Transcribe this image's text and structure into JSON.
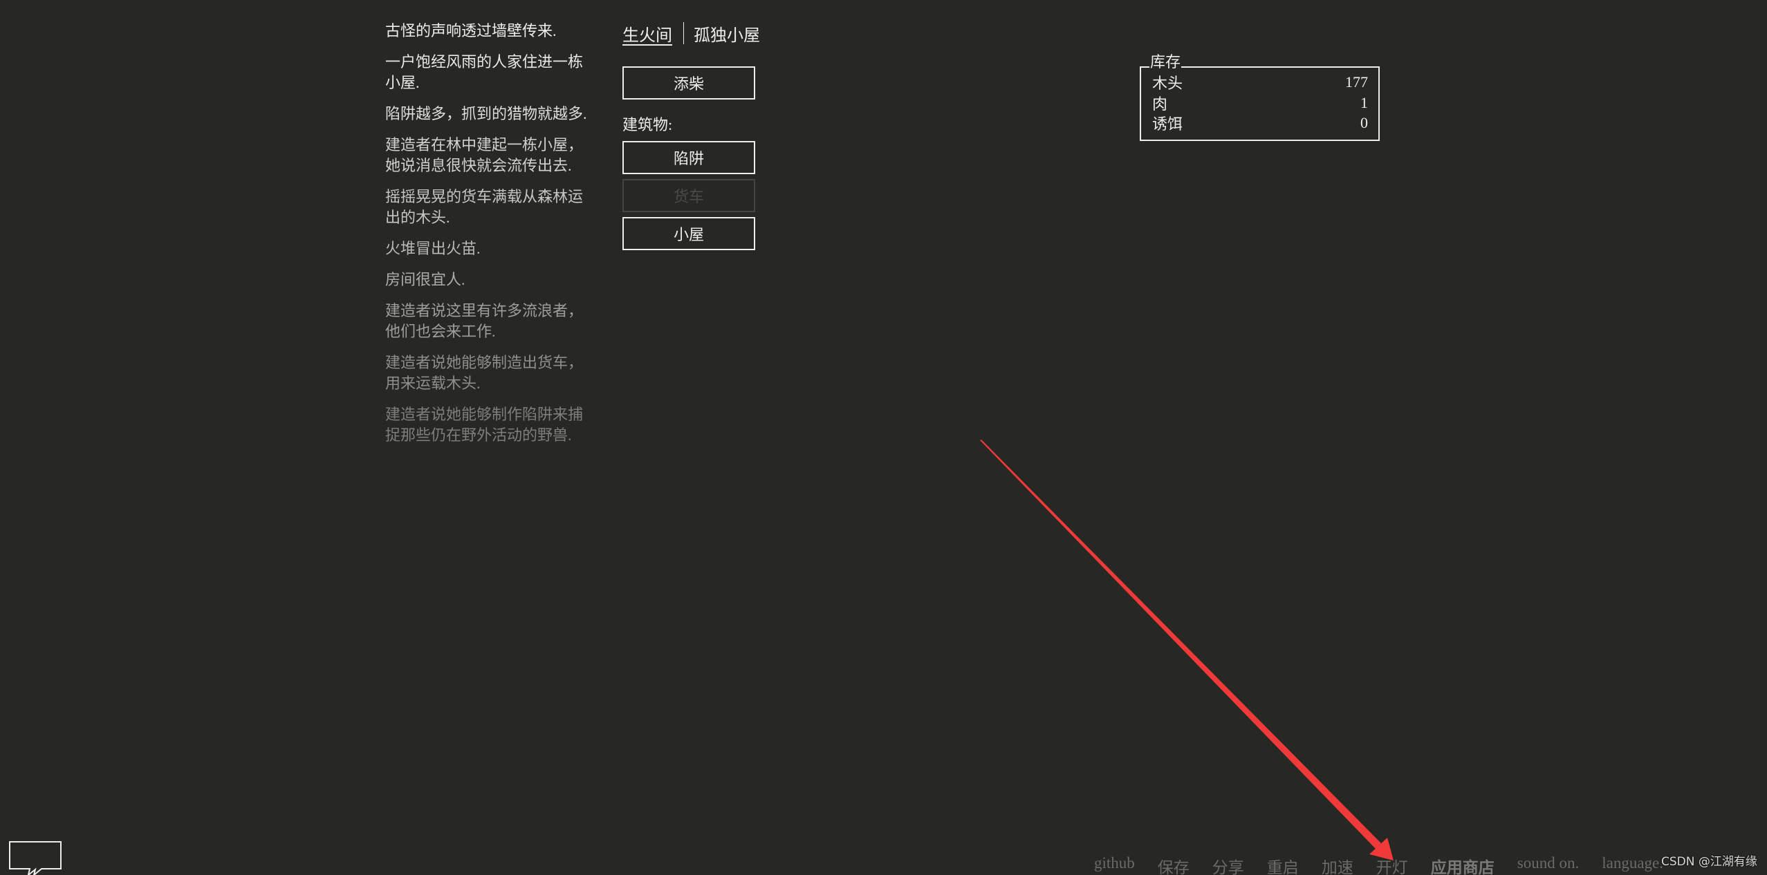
{
  "header": {
    "tabs": [
      {
        "label": "生火间",
        "selected": true
      },
      {
        "label": "孤独小屋",
        "selected": false
      }
    ]
  },
  "notifications": [
    {
      "text": "古怪的声响透过墙壁传来.",
      "color": "#eeeeee"
    },
    {
      "text": "一户饱经风雨的人家住进一栋小屋.",
      "color": "#eaeaea"
    },
    {
      "text": "陷阱越多，抓到的猎物就越多.",
      "color": "#dedede"
    },
    {
      "text": "建造者在林中建起一栋小屋，她说消息很快就会流传出去.",
      "color": "#d2d2d2"
    },
    {
      "text": "摇摇晃晃的货车满载从森林运出的木头.",
      "color": "#c6c6c6"
    },
    {
      "text": "火堆冒出火苗.",
      "color": "#bababa"
    },
    {
      "text": "房间很宜人.",
      "color": "#adadad"
    },
    {
      "text": "建造者说这里有许多流浪者，他们也会来工作.",
      "color": "#9e9e9e"
    },
    {
      "text": "建造者说她能够制造出货车，用来运载木头.",
      "color": "#8e8e8e"
    },
    {
      "text": "建造者说她能够制作陷阱来捕捉那些仍在野外活动的野兽.",
      "color": "#7e7e7e"
    }
  ],
  "actions": {
    "stoke_fire": "添柴",
    "build_label": "建筑物:",
    "build_buttons": [
      {
        "label": "陷阱",
        "disabled": false
      },
      {
        "label": "货车",
        "disabled": true
      },
      {
        "label": "小屋",
        "disabled": false
      }
    ]
  },
  "stores": {
    "title": "库存",
    "items": [
      {
        "name": "木头",
        "value": "177"
      },
      {
        "name": "肉",
        "value": "1"
      },
      {
        "name": "诱饵",
        "value": "0"
      }
    ]
  },
  "menu": {
    "items": [
      {
        "label": "github",
        "strong": false
      },
      {
        "label": "保存",
        "strong": false
      },
      {
        "label": "分享",
        "strong": false
      },
      {
        "label": "重启",
        "strong": false
      },
      {
        "label": "加速",
        "strong": false
      },
      {
        "label": "开灯",
        "strong": false
      },
      {
        "label": "应用商店",
        "strong": true
      },
      {
        "label": "sound on.",
        "strong": false
      },
      {
        "label": "language.",
        "strong": false
      }
    ]
  },
  "icons": {
    "feedback": "speech-bubble-icon"
  },
  "annotation": {
    "type": "arrow",
    "color": "#f03a3a",
    "target": "开灯"
  },
  "watermark": "CSDN @江湖有缘"
}
